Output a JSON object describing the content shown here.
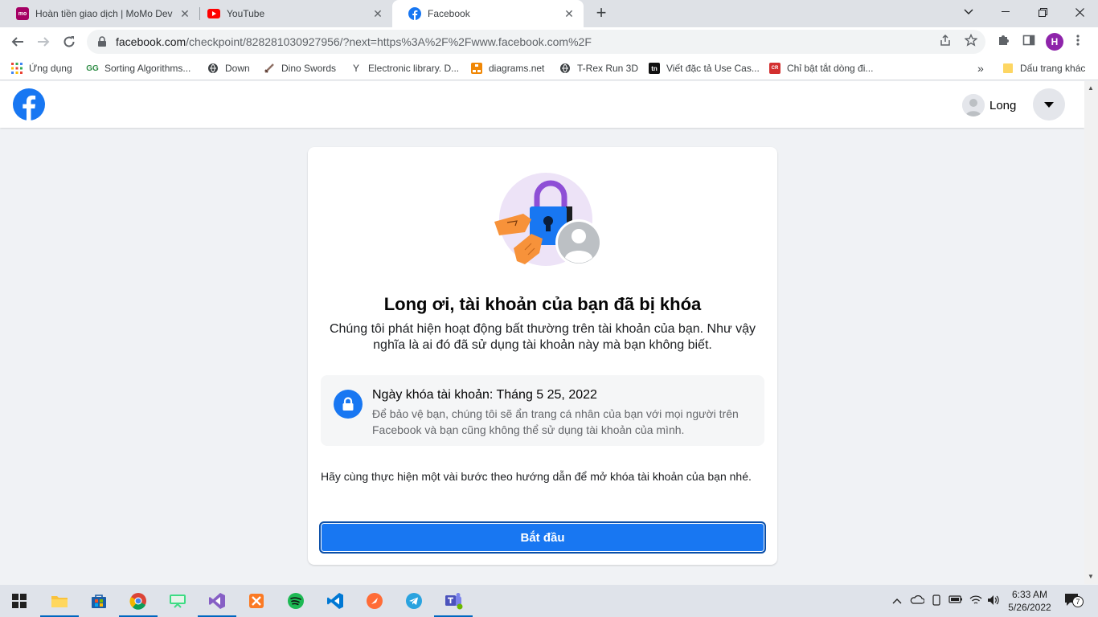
{
  "browser": {
    "tabs": [
      {
        "title": "Hoàn tiền giao dịch | MoMo Dev",
        "icon": "momo-icon",
        "color": "#a50064"
      },
      {
        "title": "YouTube",
        "icon": "youtube-icon",
        "color": "#ff0000"
      },
      {
        "title": "Facebook",
        "icon": "facebook-icon",
        "color": "#1877f2"
      }
    ],
    "new_tab": "+",
    "url_host": "facebook.com",
    "url_rest": "/checkpoint/828281030927956/?next=https%3A%2F%2Fwww.facebook.com%2F",
    "profile_initial": "H",
    "profile_color": "#8e24aa"
  },
  "bookmarks": [
    {
      "label": "Ứng dụng",
      "icon": "apps-grid-icon"
    },
    {
      "label": "Sorting Algorithms...",
      "icon": "geeksforgeeks-icon"
    },
    {
      "label": "Down",
      "icon": "globe-icon"
    },
    {
      "label": "Dino Swords",
      "icon": "sword-icon"
    },
    {
      "label": "Electronic library. D...",
      "icon": "library-icon"
    },
    {
      "label": "diagrams.net",
      "icon": "diagrams-icon"
    },
    {
      "label": "T-Rex Run 3D",
      "icon": "globe-icon"
    },
    {
      "label": "Viết đặc tả Use Cas...",
      "icon": "tn-icon"
    },
    {
      "label": "Chỉ bật tắt dòng đi...",
      "icon": "site-icon"
    }
  ],
  "bookmarks_overflow": "»",
  "bookmarks_other": "Dấu trang khác",
  "facebook": {
    "user_name": "Long",
    "brand_color": "#1877f2",
    "heading": "Long ơi, tài khoản của bạn đã bị khóa",
    "subtext": "Chúng tôi phát hiện hoạt động bất thường trên tài khoản của bạn. Như vậy nghĩa là ai đó đã sử dụng tài khoản này mà bạn không biết.",
    "info_title": "Ngày khóa tài khoản: Tháng 5 25, 2022",
    "info_desc": "Để bảo vệ bạn, chúng tôi sẽ ẩn trang cá nhân của bạn với mọi người trên Facebook và bạn cũng không thể sử dụng tài khoản của mình.",
    "steps_text": "Hãy cùng thực hiện một vài bước theo hướng dẫn để mở khóa tài khoản của bạn nhé.",
    "start_button": "Bắt đầu"
  },
  "taskbar": {
    "time": "6:33 AM",
    "date": "5/26/2022",
    "notification_count": "7"
  }
}
